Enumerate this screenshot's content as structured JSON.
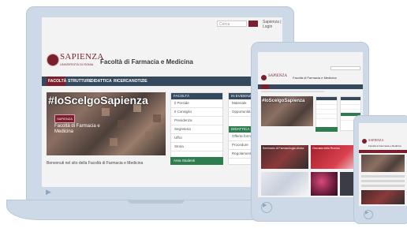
{
  "laptop": {
    "search_placeholder": "Cerca",
    "utility_links": "Sapienza  |  Login",
    "logo": {
      "name": "SAPIENZA",
      "sub": "UNIVERSITÀ DI ROMA"
    },
    "faculty_name": "Facoltà di Farmacia e Medicina",
    "nav": [
      "FACOLTÀ",
      "STRUTTURE",
      "DIDATTICA",
      "RICERCA",
      "NOTIZIE"
    ],
    "hero": {
      "hashtag": "#IoScelgoSapienza",
      "badge": "SAPIENZA",
      "text": "Facoltà di Farmacia e Medicina"
    },
    "welcome": "Benvenuti nel sito della Facoltà di Farmacia e Medicina",
    "panel_facolta": {
      "title": "FACOLTÀ",
      "items": [
        "Il Preside",
        "Il Consiglio",
        "Presidenza",
        "Segreteria",
        "Uffici",
        "Storia"
      ],
      "cta": "Area Studenti"
    },
    "panel_news": {
      "title": "IN EVIDENZA",
      "items": [
        "Materiale",
        "Opportunità"
      ],
      "didattica_title": "DIDATTICA",
      "didattica_items": [
        "Offerta formativa",
        "Procedure",
        "Regolamenti"
      ]
    }
  },
  "tablet": {
    "logo": "SAPIENZA",
    "faculty_name": "Facoltà di Farmacia e Medicina",
    "hashtag": "#IoScelgoSapienza",
    "cards": [
      {
        "title": "Seminario di Farmacologia clinica"
      },
      {
        "title": "Giornata della Ricerca"
      }
    ],
    "panel_title": "FACOLTÀ"
  },
  "phone": {
    "logo": "SAPIENZA",
    "faculty_name": "Facoltà di Farmacia e Medicina"
  },
  "colors": {
    "brand": "#7a1f2b",
    "nav": "#34495e",
    "accent_green": "#2e7d4f",
    "device": "#cdd9e6"
  }
}
